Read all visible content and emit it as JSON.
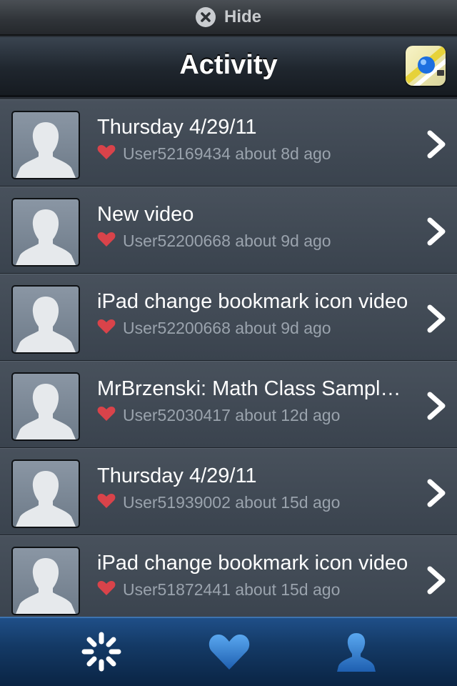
{
  "hide_bar": {
    "label": "Hide"
  },
  "nav": {
    "title": "Activity"
  },
  "activity": [
    {
      "title": "Thursday 4/29/11",
      "subtitle": "User52169434 about 8d ago"
    },
    {
      "title": "New video",
      "subtitle": "User52200668 about 9d ago"
    },
    {
      "title": "iPad change bookmark icon video",
      "subtitle": "User52200668 about 9d ago"
    },
    {
      "title": "MrBrzenski: Math Class Sampl…",
      "subtitle": "User52030417 about 12d ago"
    },
    {
      "title": "Thursday 4/29/11",
      "subtitle": "User51939002 about 15d ago"
    },
    {
      "title": "iPad change bookmark icon video",
      "subtitle": "User51872441 about 15d ago"
    }
  ],
  "tabs": [
    {
      "icon": "activity-spinner-icon",
      "selected": true
    },
    {
      "icon": "heart-icon",
      "selected": false
    },
    {
      "icon": "profile-icon",
      "selected": false
    }
  ],
  "colors": {
    "heart": "#d9434a",
    "tab_bar": "#143a66",
    "row_subtitle": "#9aa3ad"
  }
}
